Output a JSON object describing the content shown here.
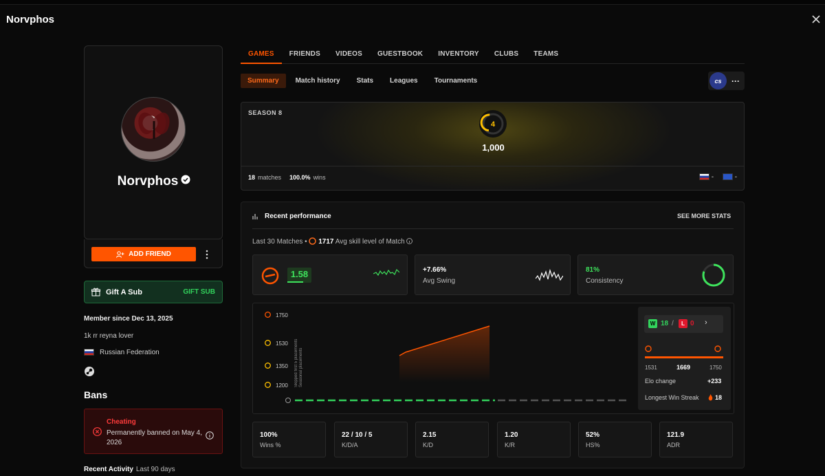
{
  "window": {
    "title": "Norvphos"
  },
  "profile": {
    "name": "Norvphos",
    "add_friend_label": "ADD FRIEND",
    "gift": {
      "label": "Gift A Sub",
      "button": "GIFT SUB"
    },
    "member_since": "Member since Dec 13, 2025",
    "bio": "1k rr reyna lover",
    "country": "Russian Federation"
  },
  "bans": {
    "title": "Bans",
    "type": "Cheating",
    "detail": "Permanently banned on May 4, 2026"
  },
  "recent_activity": {
    "title": "Recent Activity",
    "period": "Last 90 days"
  },
  "tabs": [
    "GAMES",
    "FRIENDS",
    "VIDEOS",
    "GUESTBOOK",
    "INVENTORY",
    "CLUBS",
    "TEAMS"
  ],
  "active_tab": "GAMES",
  "subtabs": [
    "Summary",
    "Match history",
    "Stats",
    "Leagues",
    "Tournaments"
  ],
  "active_subtab": "Summary",
  "game_badge": {
    "logo_text": "cs"
  },
  "season": {
    "title": "SEASON 8",
    "level": "4",
    "elo": "1,000",
    "matches_value": "18",
    "matches_label": "matches",
    "wins_value": "100.0%",
    "wins_label": "wins",
    "region_rank_1": "-",
    "region_rank_2": "-"
  },
  "performance": {
    "title": "Recent performance",
    "see_more": "SEE MORE STATS",
    "last_matches": "Last 30 Matches",
    "avg_skill_value": "1717",
    "avg_skill_label": "Avg skill level of Match",
    "kd_card_value": "1.58",
    "swing_value": "+7.66%",
    "swing_label": "Avg Swing",
    "consistency_value": "81%",
    "consistency_label": "Consistency",
    "chart": {
      "y_ticks": [
        "1750",
        "1530",
        "1350",
        "1200"
      ],
      "side_note": "Skipped first 5 placements\nSeasonal placements"
    },
    "wl": {
      "wins": "18",
      "sep": "/",
      "losses": "0"
    },
    "elo_range": {
      "min": "1531",
      "current": "1669",
      "max": "1750"
    },
    "elo_change_label": "Elo change",
    "elo_change_value": "+233",
    "streak_label": "Longest Win Streak",
    "streak_value": "18",
    "stats": [
      {
        "value": "100%",
        "label": "Wins %"
      },
      {
        "value": "22 / 10 / 5",
        "label": "K/D/A"
      },
      {
        "value": "2.15",
        "label": "K/D"
      },
      {
        "value": "1.20",
        "label": "K/R"
      },
      {
        "value": "52%",
        "label": "HS%"
      },
      {
        "value": "121.9",
        "label": "ADR"
      }
    ]
  },
  "colors": {
    "accent": "#ff5500",
    "win": "#32d35c",
    "loss": "#e0182d",
    "level": "#ffc000"
  }
}
